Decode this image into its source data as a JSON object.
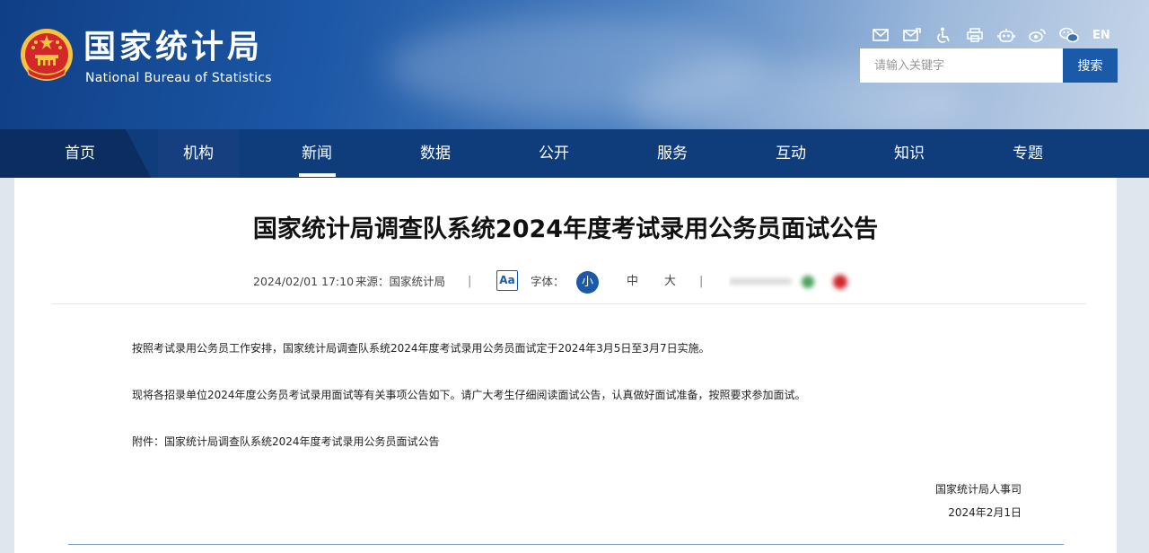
{
  "site": {
    "name_cn": "国家统计局",
    "name_en": "National Bureau of Statistics"
  },
  "toolbar": {
    "icons": [
      "mail-icon",
      "mail-send-icon",
      "accessibility-icon",
      "print-icon",
      "robot-icon",
      "weibo-icon",
      "wechat-icon"
    ],
    "lang_label": "EN"
  },
  "search": {
    "placeholder": "请输入关键字",
    "value": "",
    "button_label": "搜索"
  },
  "nav": {
    "items": [
      {
        "label": "首页"
      },
      {
        "label": "机构"
      },
      {
        "label": "新闻"
      },
      {
        "label": "数据"
      },
      {
        "label": "公开"
      },
      {
        "label": "服务"
      },
      {
        "label": "互动"
      },
      {
        "label": "知识"
      },
      {
        "label": "专题"
      }
    ],
    "active": "新闻"
  },
  "article": {
    "title": "国家统计局调查队系统2024年度考试录用公务员面试公告",
    "datetime": "2024/02/01 17:10",
    "source_label": "来源：国家统计局",
    "font_icon_label": "Aa",
    "font_label": "字体：",
    "font_sizes": [
      "小",
      "中",
      "大"
    ],
    "font_size_selected": "小",
    "separator": "|",
    "paragraphs": [
      "按照考试录用公务员工作安排，国家统计局调查队系统2024年度考试录用公务员面试定于2024年3月5日至3月7日实施。",
      "现将各招录单位2024年度公务员考试录用面试等有关事项公告如下。请广大考生仔细阅读面试公告，认真做好面试准备，按照要求参加面试。",
      "附件：国家统计局调查队系统2024年度考试录用公务员面试公告"
    ],
    "signoff_org": "国家统计局人事司",
    "signoff_date": "2024年2月1日"
  },
  "colors": {
    "brand_blue": "#1b5aa8",
    "nav_bg": "#0f3c7a",
    "emblem_red": "#d4272a",
    "emblem_gold": "#f6c343"
  }
}
